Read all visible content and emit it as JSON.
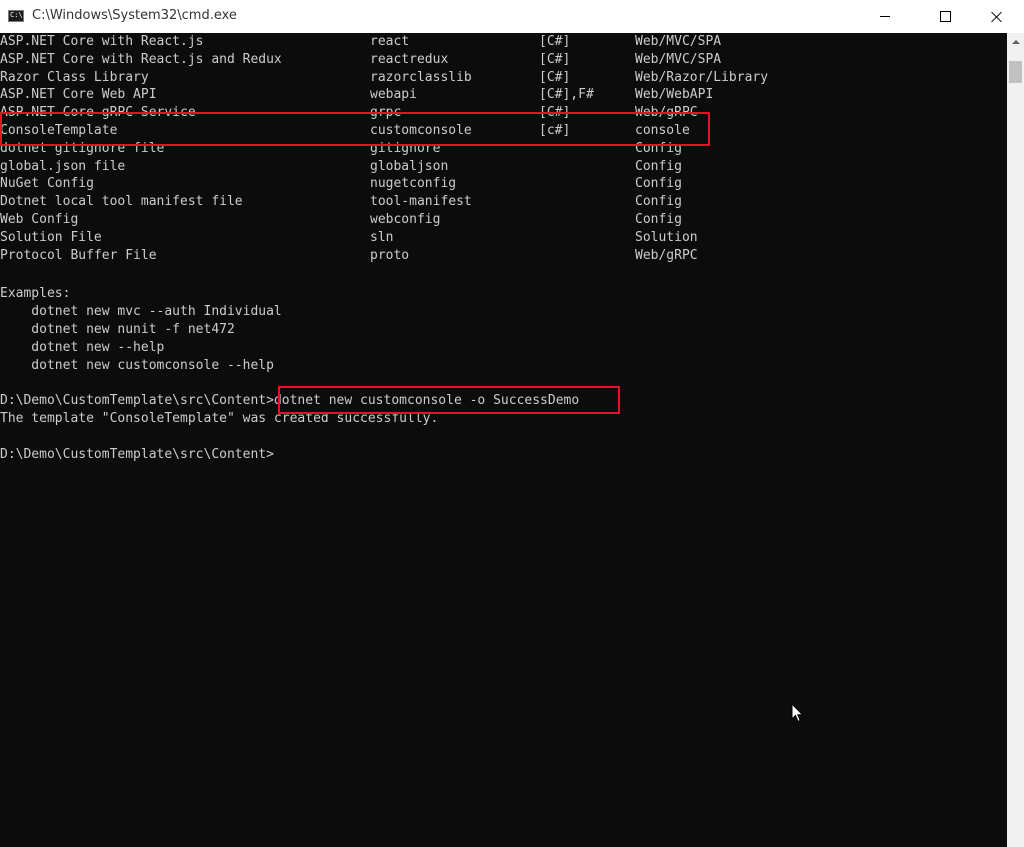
{
  "window": {
    "title": "C:\\Windows\\System32\\cmd.exe",
    "icon_text": "C:\\",
    "controls": [
      "minimize",
      "maximize",
      "close"
    ]
  },
  "templates": [
    {
      "name": "ASP.NET Core with React.js",
      "short": "react",
      "lang": "[C#]",
      "tags": "Web/MVC/SPA"
    },
    {
      "name": "ASP.NET Core with React.js and Redux",
      "short": "reactredux",
      "lang": "[C#]",
      "tags": "Web/MVC/SPA"
    },
    {
      "name": "Razor Class Library",
      "short": "razorclasslib",
      "lang": "[C#]",
      "tags": "Web/Razor/Library"
    },
    {
      "name": "ASP.NET Core Web API",
      "short": "webapi",
      "lang": "[C#],F#",
      "tags": "Web/WebAPI"
    },
    {
      "name": "ASP.NET Core gRPC Service",
      "short": "grpc",
      "lang": "[C#]",
      "tags": "Web/gRPC"
    },
    {
      "name": "ConsoleTemplate",
      "short": "customconsole",
      "lang": "[c#]",
      "tags": "console"
    },
    {
      "name": "dotnet gitignore file",
      "short": "gitignore",
      "lang": "",
      "tags": "Config"
    },
    {
      "name": "global.json file",
      "short": "globaljson",
      "lang": "",
      "tags": "Config"
    },
    {
      "name": "NuGet Config",
      "short": "nugetconfig",
      "lang": "",
      "tags": "Config"
    },
    {
      "name": "Dotnet local tool manifest file",
      "short": "tool-manifest",
      "lang": "",
      "tags": "Config"
    },
    {
      "name": "Web Config",
      "short": "webconfig",
      "lang": "",
      "tags": "Config"
    },
    {
      "name": "Solution File",
      "short": "sln",
      "lang": "",
      "tags": "Solution"
    },
    {
      "name": "Protocol Buffer File",
      "short": "proto",
      "lang": "",
      "tags": "Web/gRPC"
    }
  ],
  "examples": {
    "heading": "Examples:",
    "lines": [
      "    dotnet new mvc --auth Individual",
      "    dotnet new nunit -f net472",
      "    dotnet new --help",
      "    dotnet new customconsole --help"
    ]
  },
  "session": {
    "prompt1": "D:\\Demo\\CustomTemplate\\src\\Content>",
    "command": "dotnet new customconsole -o SuccessDemo",
    "output": "The template \"ConsoleTemplate\" was created successfully.",
    "prompt2": "D:\\Demo\\CustomTemplate\\src\\Content>"
  },
  "colors": {
    "background": "#0c0c0c",
    "text": "#cccccc",
    "highlight": "#e81123"
  }
}
